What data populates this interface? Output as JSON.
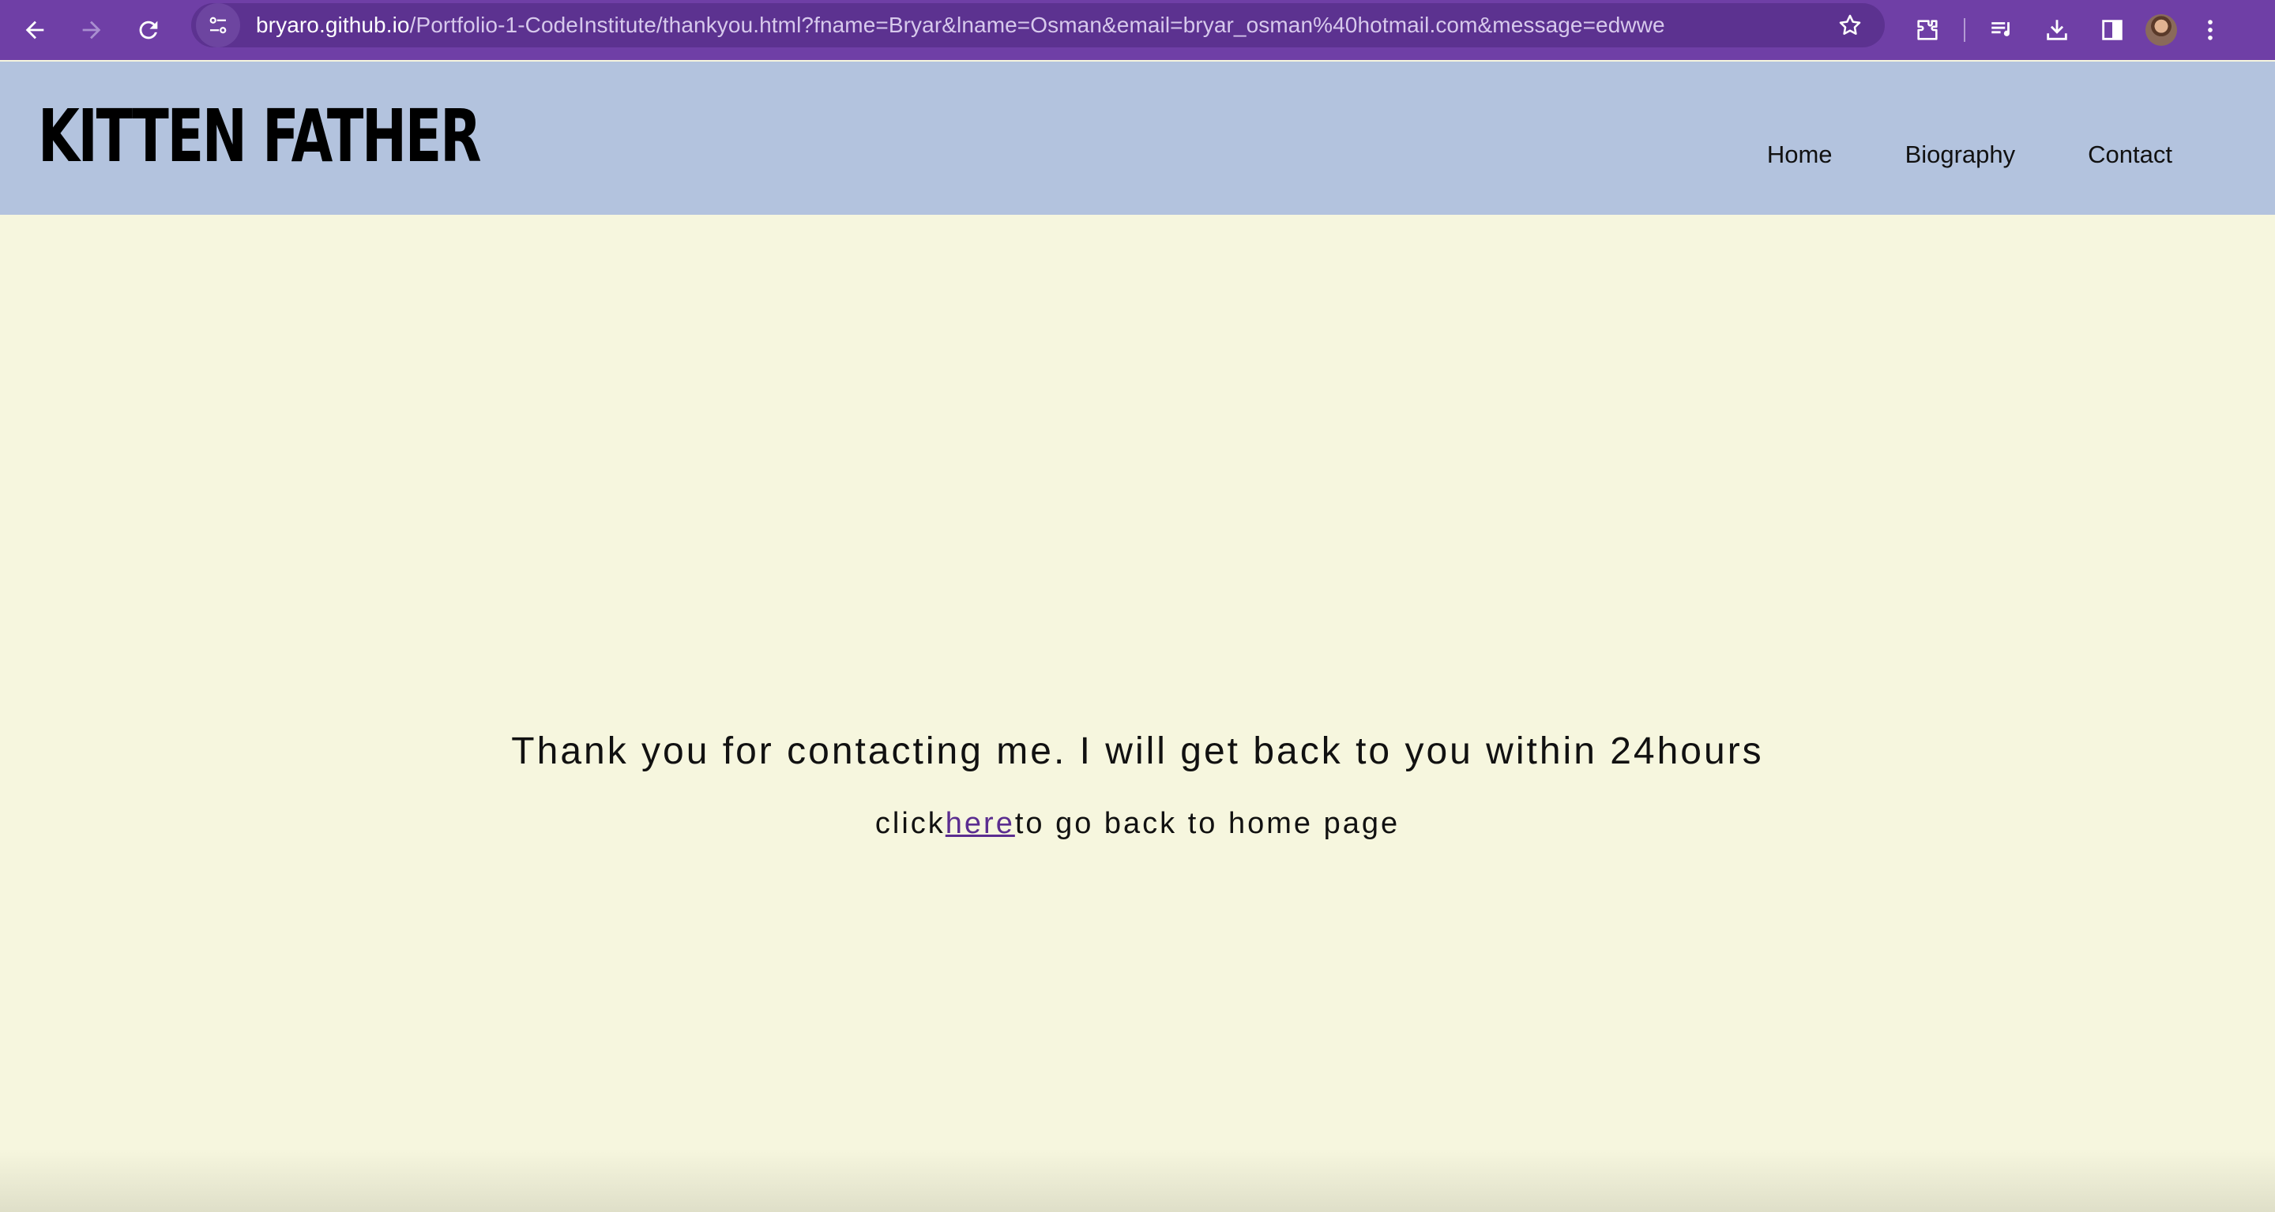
{
  "browser": {
    "url_domain": "bryaro.github.io",
    "url_path": "/Portfolio-1-CodeInstitute/thankyou.html?fname=Bryar&lname=Osman&email=bryar_osman%40hotmail.com&message=edwwe",
    "icons": [
      "back-arrow-icon",
      "forward-arrow-icon",
      "reload-icon",
      "site-info-icon",
      "star-icon",
      "extensions-icon",
      "media-control-icon",
      "download-icon",
      "side-panel-icon",
      "avatar",
      "more-menu-icon"
    ],
    "accent_color": "#6f3fa6"
  },
  "header": {
    "brand": "KITTEN FATHER",
    "nav": [
      "Home",
      "Biography",
      "Contact"
    ],
    "background_color": "#b3c3de"
  },
  "main": {
    "thanks_message": "Thank you for contacting me. I will get back to you within 24hours",
    "back_prefix": "click",
    "back_link": "here",
    "back_suffix": "to go back to home page",
    "background_color": "#f6f6de",
    "link_color": "#5b2d90"
  }
}
